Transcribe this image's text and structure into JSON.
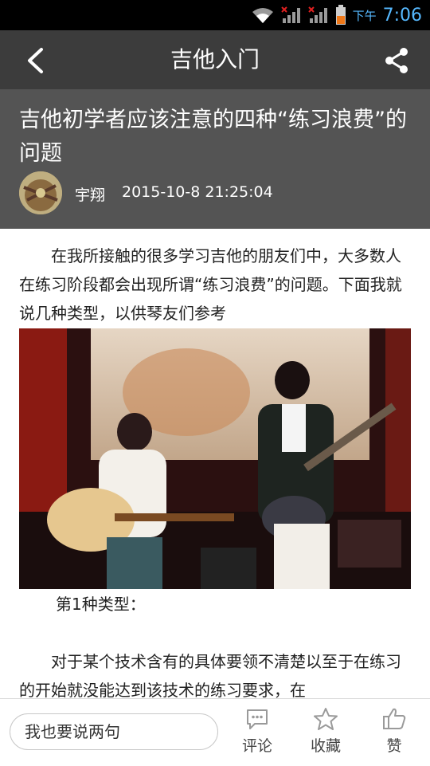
{
  "status_bar": {
    "ampm": "下午",
    "time": "7:06"
  },
  "nav": {
    "title": "吉他入门",
    "back_icon": "back-arrow-icon",
    "share_icon": "share-icon"
  },
  "article": {
    "title": "吉他初学者应该注意的四种“练习浪费”的问题",
    "author": "宇翔",
    "date": "2015-10-8 21:25:04",
    "intro": "在我所接触的很多学习吉他的朋友们中，大多数人在练习阶段都会出现所谓“练习浪费”的问题。下面我就说几种类型，以供琴友们参考",
    "section1_heading": "第1种类型：",
    "section1_text": "对于某个技术含有的具体要领不清楚以至于在练习的开始就没能达到该技术的练习要求，在"
  },
  "bottom_bar": {
    "input_placeholder": "我也要说两句",
    "comment_label": "评论",
    "favorite_label": "收藏",
    "like_label": "赞"
  },
  "colors": {
    "status_bar": "#000000",
    "nav_bar": "#3c3c3c",
    "header_bg": "#545454",
    "time_accent": "#56b9ff"
  }
}
